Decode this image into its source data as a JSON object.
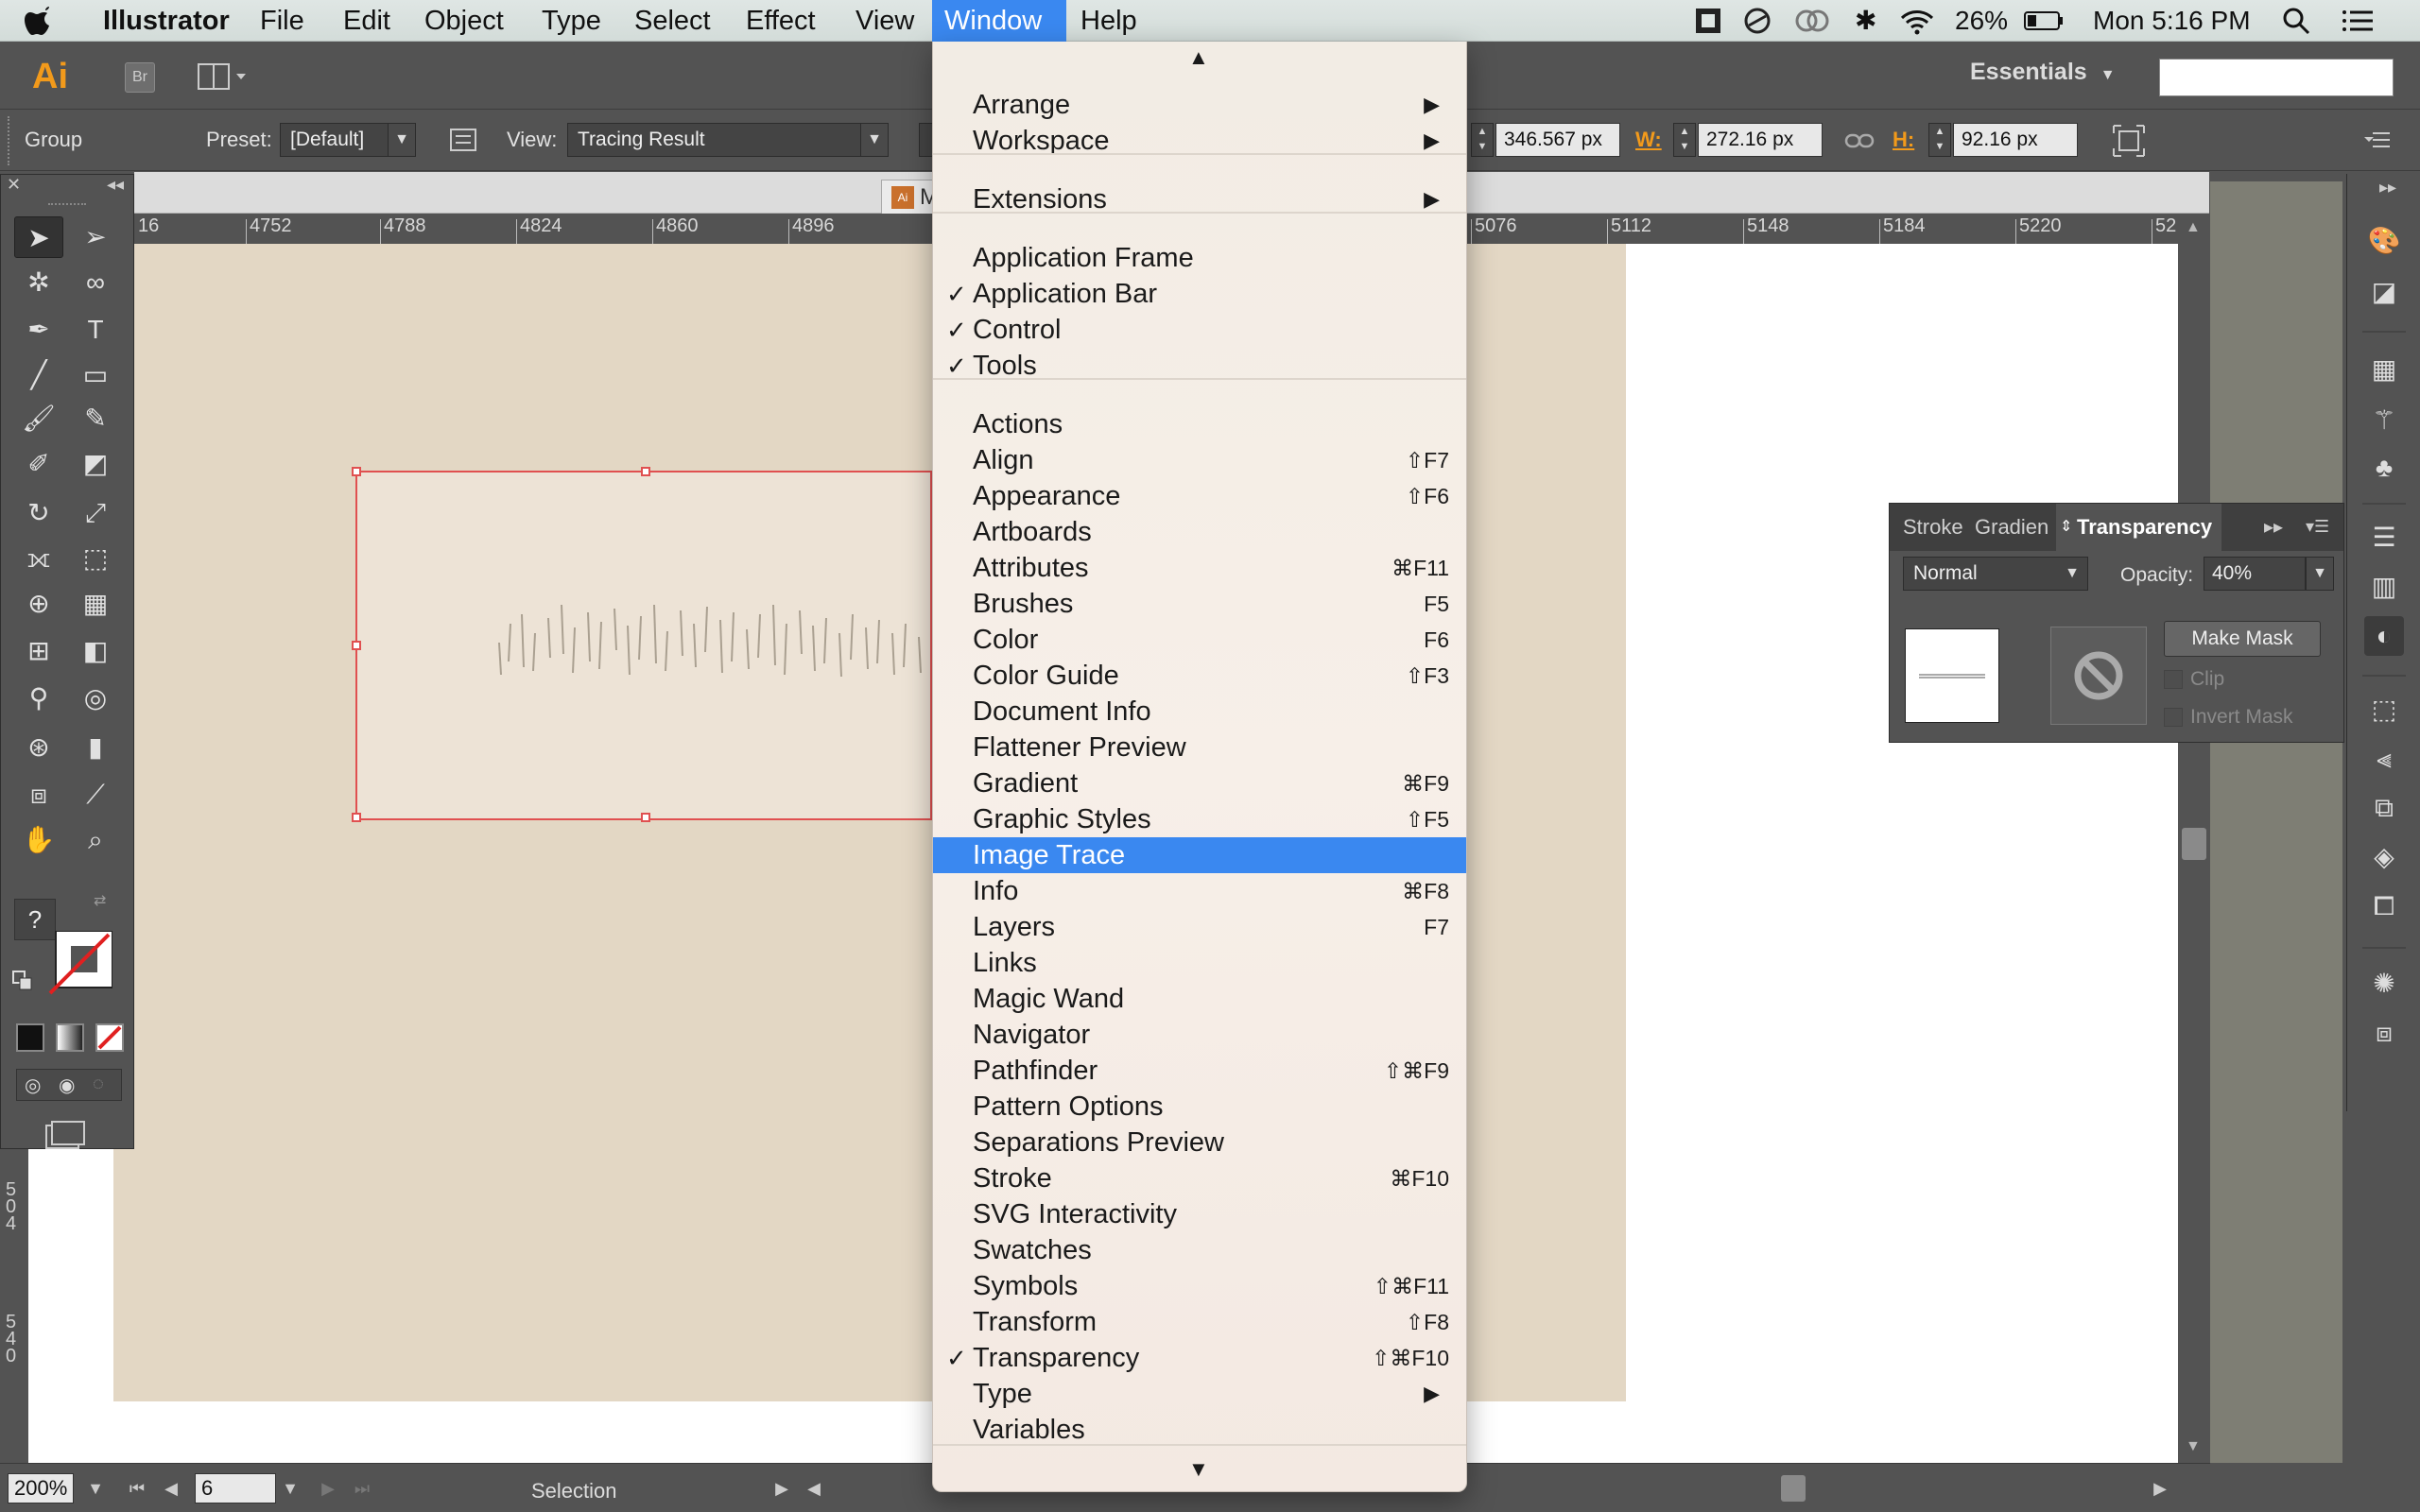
{
  "menubar": {
    "app": "Illustrator",
    "items": [
      "File",
      "Edit",
      "Object",
      "Type",
      "Select",
      "Effect",
      "View",
      "Window",
      "Help"
    ],
    "status": {
      "battery": "26%",
      "datetime": "Mon 5:16 PM"
    }
  },
  "appbar": {
    "ai_logo": "Ai",
    "br_logo": "Br",
    "workspace": "Essentials"
  },
  "control": {
    "group_label": "Group",
    "preset_label": "Preset:",
    "preset_value": "[Default]",
    "view_label": "View:",
    "view_value": "Tracing Result",
    "x_value": "346.567 px",
    "w_label": "W:",
    "w_value": "272.16 px",
    "h_label": "H:",
    "h_value": "92.16 px"
  },
  "document": {
    "tab_initial": "M"
  },
  "ruler": {
    "h_ticks": [
      "16",
      "4752",
      "4788",
      "4824",
      "4860",
      "4896",
      "5076",
      "5112",
      "5148",
      "5184",
      "5220",
      "52"
    ],
    "v_ticks": [
      "5\n0\n4",
      "5\n4\n0"
    ]
  },
  "statusbar": {
    "zoom": "200%",
    "artboard": "6",
    "tool": "Selection"
  },
  "transparency_panel": {
    "tabs": [
      "Stroke",
      "Gradien",
      "Transparency"
    ],
    "blend_mode": "Normal",
    "opacity_label": "Opacity:",
    "opacity_value": "40%",
    "make_mask": "Make Mask",
    "clip": "Clip",
    "invert_mask": "Invert Mask"
  },
  "window_menu": {
    "items": [
      {
        "label": "Arrange",
        "submenu": "▶"
      },
      {
        "label": "Workspace",
        "submenu": "▶"
      },
      {
        "label": "Extensions",
        "submenu": "▶"
      },
      {
        "label": "Application Frame"
      },
      {
        "label": "Application Bar",
        "check": "✓"
      },
      {
        "label": "Control",
        "check": "✓"
      },
      {
        "label": "Tools",
        "check": "✓"
      },
      {
        "label": "Actions"
      },
      {
        "label": "Align",
        "shortcut": "⇧F7"
      },
      {
        "label": "Appearance",
        "shortcut": "⇧F6"
      },
      {
        "label": "Artboards"
      },
      {
        "label": "Attributes",
        "shortcut": "⌘F11"
      },
      {
        "label": "Brushes",
        "shortcut": "F5"
      },
      {
        "label": "Color",
        "shortcut": "F6"
      },
      {
        "label": "Color Guide",
        "shortcut": "⇧F3"
      },
      {
        "label": "Document Info"
      },
      {
        "label": "Flattener Preview"
      },
      {
        "label": "Gradient",
        "shortcut": "⌘F9"
      },
      {
        "label": "Graphic Styles",
        "shortcut": "⇧F5"
      },
      {
        "label": "Image Trace"
      },
      {
        "label": "Info",
        "shortcut": "⌘F8"
      },
      {
        "label": "Layers",
        "shortcut": "F7"
      },
      {
        "label": "Links"
      },
      {
        "label": "Magic Wand"
      },
      {
        "label": "Navigator"
      },
      {
        "label": "Pathfinder",
        "shortcut": "⇧⌘F9"
      },
      {
        "label": "Pattern Options"
      },
      {
        "label": "Separations Preview"
      },
      {
        "label": "Stroke",
        "shortcut": "⌘F10"
      },
      {
        "label": "SVG Interactivity"
      },
      {
        "label": "Swatches"
      },
      {
        "label": "Symbols",
        "shortcut": "⇧⌘F11"
      },
      {
        "label": "Transform",
        "shortcut": "⇧F8"
      },
      {
        "label": "Transparency",
        "check": "✓",
        "shortcut": "⇧⌘F10"
      },
      {
        "label": "Type",
        "submenu": "▶"
      },
      {
        "label": "Variables"
      }
    ]
  },
  "colors": {
    "accent": "#3a88f0",
    "ai_orange": "#f29a1b",
    "selection": "#e05050",
    "artboard": "#e3d7c4"
  }
}
